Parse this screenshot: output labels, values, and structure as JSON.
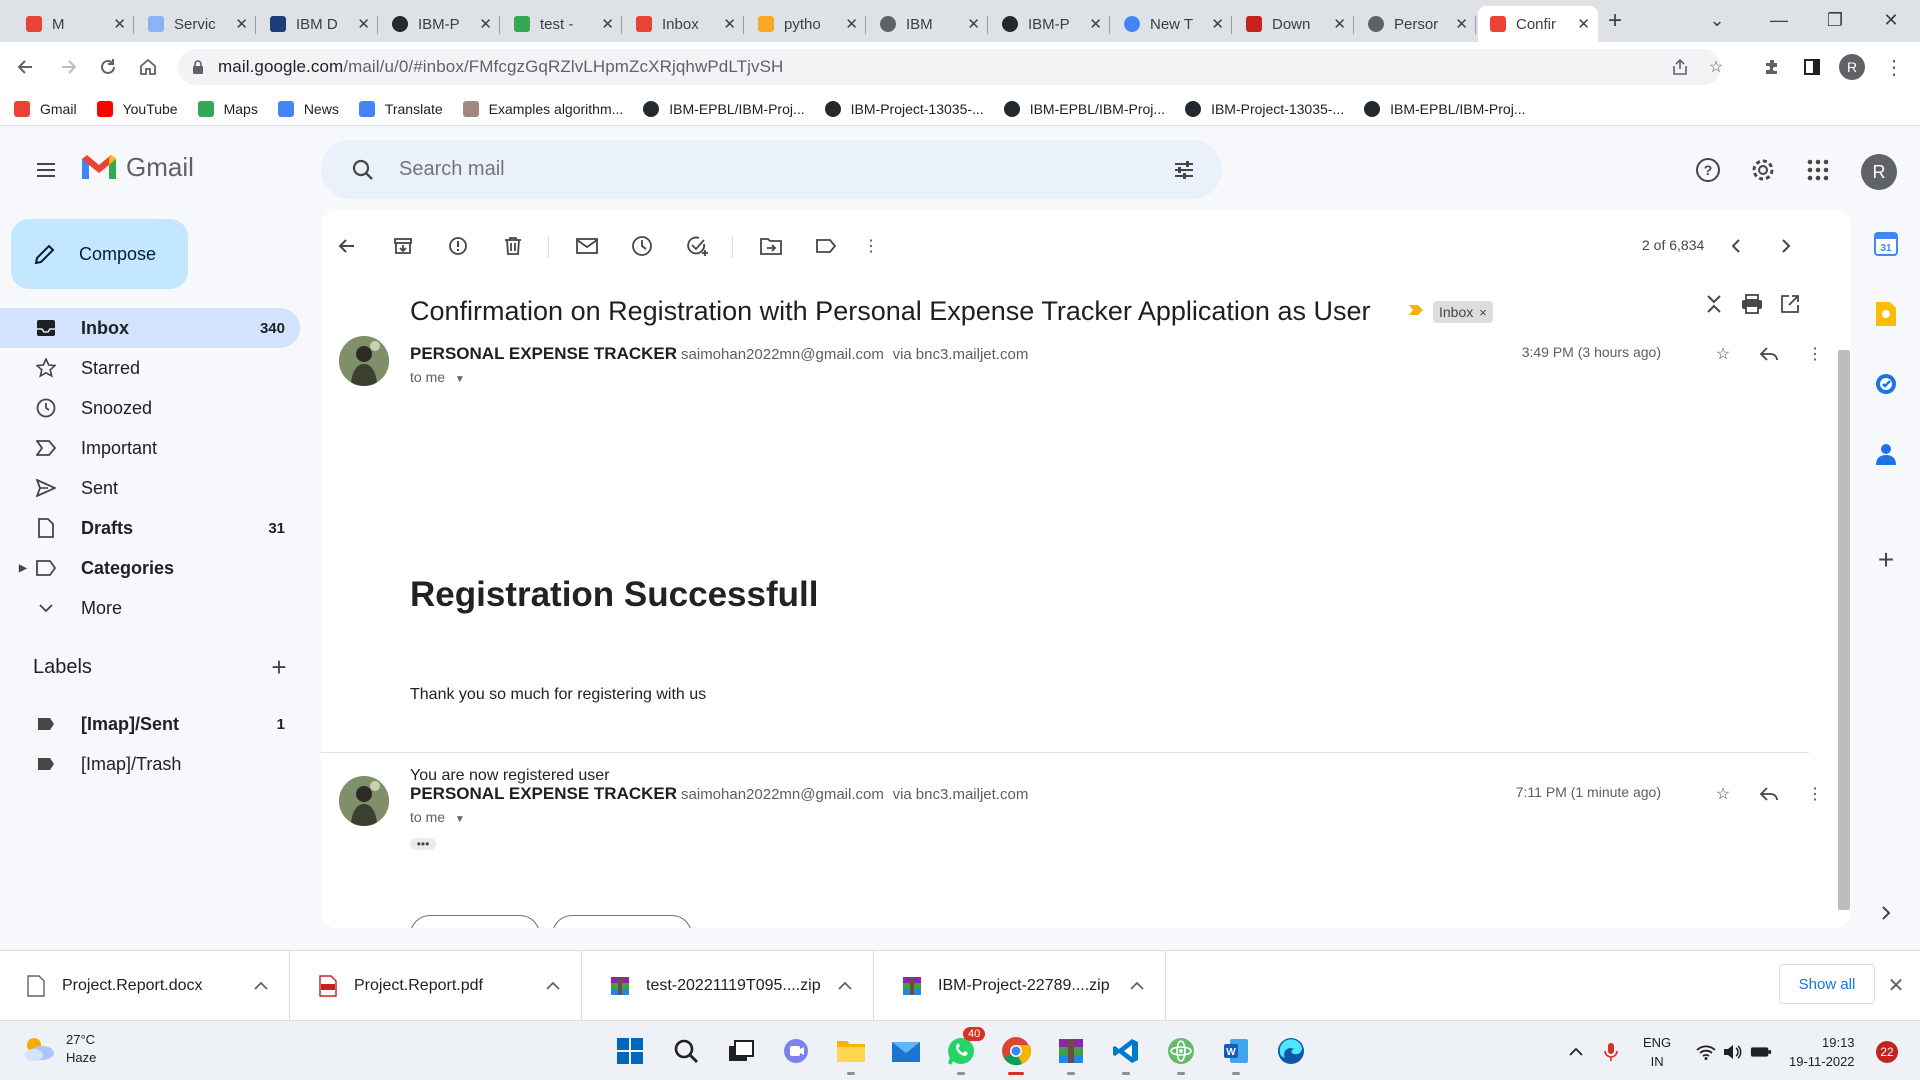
{
  "browser": {
    "tabs": [
      {
        "title": "M",
        "icon": "gmail-recording-icon"
      },
      {
        "title": "Servic",
        "icon": "cloud-icon"
      },
      {
        "title": "IBM D",
        "icon": "ibm-icon"
      },
      {
        "title": "IBM-P",
        "icon": "github-icon"
      },
      {
        "title": "test - ",
        "icon": "google-drive-icon"
      },
      {
        "title": "Inbox",
        "icon": "gmail-icon"
      },
      {
        "title": "pytho",
        "icon": "python-icon"
      },
      {
        "title": "IBM",
        "icon": "globe-icon"
      },
      {
        "title": "IBM-P",
        "icon": "github-icon"
      },
      {
        "title": "New T",
        "icon": "chrome-icon"
      },
      {
        "title": "Down",
        "icon": "heart-icon"
      },
      {
        "title": "Persor",
        "icon": "globe-icon"
      },
      {
        "title": "Confir",
        "icon": "gmail-icon",
        "active": true
      }
    ],
    "url_host": "mail.google.com",
    "url_path": "/mail/u/0/#inbox/FMfcgzGqRZlvLHpmZcXRjqhwPdLTjvSH",
    "profile_initial": "R",
    "bookmarks": [
      {
        "label": "Gmail",
        "icon": "gmail-icon"
      },
      {
        "label": "YouTube",
        "icon": "youtube-icon"
      },
      {
        "label": "Maps",
        "icon": "maps-icon"
      },
      {
        "label": "News",
        "icon": "news-icon"
      },
      {
        "label": "Translate",
        "icon": "translate-icon"
      },
      {
        "label": "Examples algorithm...",
        "icon": "algorithm-icon"
      },
      {
        "label": "IBM-EPBL/IBM-Proj...",
        "icon": "github-icon"
      },
      {
        "label": "IBM-Project-13035-...",
        "icon": "github-icon"
      },
      {
        "label": "IBM-EPBL/IBM-Proj...",
        "icon": "github-icon"
      },
      {
        "label": "IBM-Project-13035-...",
        "icon": "github-icon"
      },
      {
        "label": "IBM-EPBL/IBM-Proj...",
        "icon": "github-icon"
      }
    ]
  },
  "gmail": {
    "logo_text": "Gmail",
    "search_placeholder": "Search mail",
    "account_initial": "R",
    "compose_label": "Compose",
    "nav": [
      {
        "label": "Inbox",
        "count": "340",
        "icon": "inbox-icon",
        "selected": true
      },
      {
        "label": "Starred",
        "count": "",
        "icon": "star-icon"
      },
      {
        "label": "Snoozed",
        "count": "",
        "icon": "clock-icon"
      },
      {
        "label": "Important",
        "count": "",
        "icon": "important-icon"
      },
      {
        "label": "Sent",
        "count": "",
        "icon": "send-icon"
      },
      {
        "label": "Drafts",
        "count": "31",
        "icon": "draft-icon",
        "bold": true
      },
      {
        "label": "Categories",
        "count": "",
        "icon": "label-icon",
        "bold": true
      },
      {
        "label": "More",
        "count": "",
        "icon": "chevron-down-icon"
      }
    ],
    "labels_heading": "Labels",
    "labels": [
      {
        "label": "[Imap]/Sent",
        "count": "1",
        "bold": true
      },
      {
        "label": "[Imap]/Trash",
        "count": ""
      }
    ],
    "pager": "2 of 6,834",
    "subject": "Confirmation on Registration with Personal Expense Tracker Application as User",
    "subject_label_chip": "Inbox",
    "messages": [
      {
        "sender": "PERSONAL EXPENSE TRACKER",
        "email": "saimohan2022mn@gmail.com",
        "via_label": "via",
        "via": "bnc3.mailjet.com",
        "to": "to me",
        "time": "3:49 PM (3 hours ago)",
        "heading": "Registration Successfull",
        "paragraphs": [
          "Thank you so much for registering with us",
          "You are now registered user"
        ]
      },
      {
        "sender": "PERSONAL EXPENSE TRACKER",
        "email": "saimohan2022mn@gmail.com",
        "via_label": "via",
        "via": "bnc3.mailjet.com",
        "to": "to me",
        "time": "7:11 PM (1 minute ago)"
      }
    ]
  },
  "downloads": [
    {
      "name": "Project.Report.docx",
      "icon": "file-icon"
    },
    {
      "name": "Project.Report.pdf",
      "icon": "pdf-icon"
    },
    {
      "name": "test-20221119T095....zip",
      "icon": "winrar-icon"
    },
    {
      "name": "IBM-Project-22789....zip",
      "icon": "winrar-icon"
    }
  ],
  "downloads_show_all": "Show all",
  "taskbar": {
    "weather_temp": "27°C",
    "weather_desc": "Haze",
    "whatsapp_badge": "40",
    "lang_1": "ENG",
    "lang_2": "IN",
    "time": "19:13",
    "date": "19-11-2022",
    "notifications": "22"
  },
  "colors": {
    "accent": "#1a73e8",
    "gmail_bg": "#f6f8fc",
    "inbox_selected": "#d3e3fd",
    "compose": "#c2e7ff"
  }
}
